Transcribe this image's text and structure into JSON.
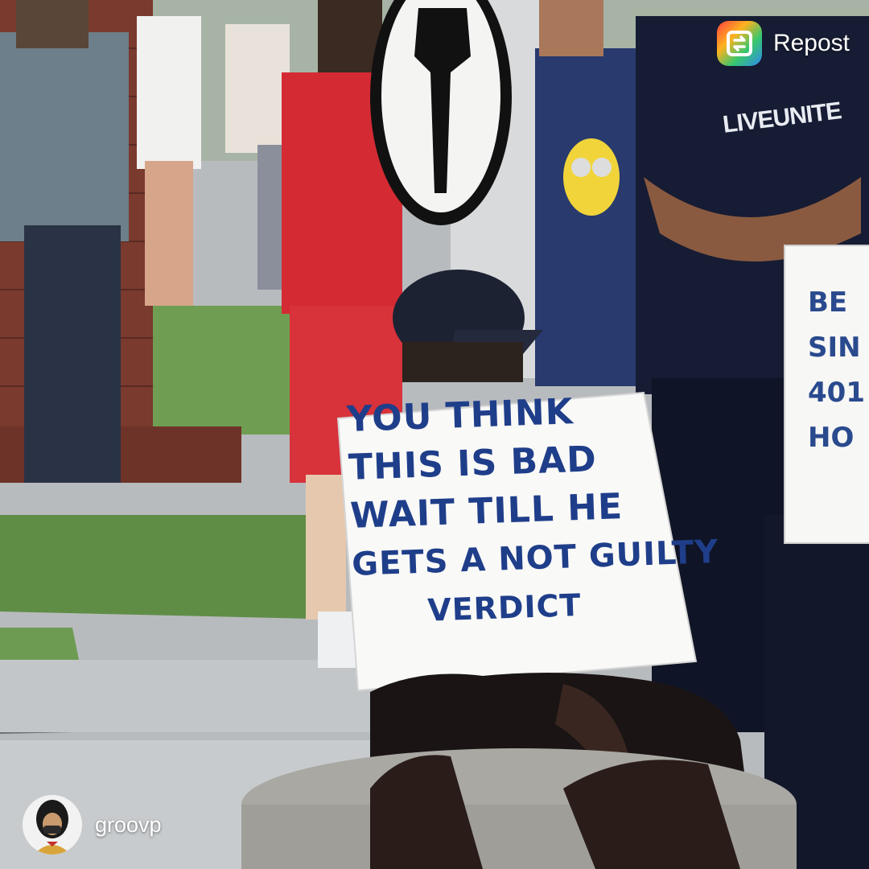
{
  "header": {
    "repost_label": "Repost",
    "repost_icon": "repost-icon"
  },
  "photo": {
    "sign_lines": [
      "You think",
      "this is bad",
      "wait till he",
      "gets a not guilty",
      "verdict"
    ],
    "shirt_text": "LIVEUNITE",
    "right_sign_fragments": [
      "BE",
      "SIN",
      "401",
      "HO"
    ]
  },
  "footer": {
    "username": "groovp",
    "avatar_icon": "profile-avatar-icon"
  },
  "colors": {
    "sign_ink": "#1f3e8a",
    "sidewalk": "#b9bcbf",
    "grass": "#6a9a4e",
    "brick": "#7a3a2e"
  }
}
